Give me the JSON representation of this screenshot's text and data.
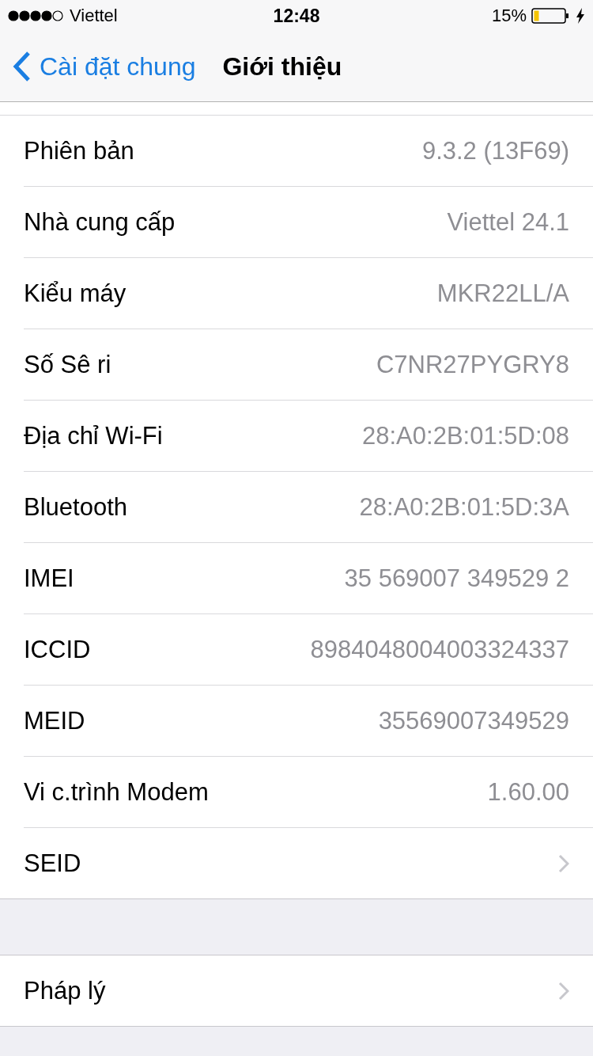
{
  "status_bar": {
    "carrier": "Viettel",
    "time": "12:48",
    "battery": "15%"
  },
  "nav": {
    "back": "Cài đặt chung",
    "title": "Giới thiệu"
  },
  "groups": [
    {
      "rows": [
        {
          "kind": "value",
          "label": "Phiên bản",
          "value": "9.3.2 (13F69)"
        },
        {
          "kind": "value",
          "label": "Nhà cung cấp",
          "value": "Viettel 24.1"
        },
        {
          "kind": "value",
          "label": "Kiểu máy",
          "value": "MKR22LL/A"
        },
        {
          "kind": "value",
          "label": "Số Sê ri",
          "value": "C7NR27PYGRY8"
        },
        {
          "kind": "value",
          "label": "Địa chỉ Wi-Fi",
          "value": "28:A0:2B:01:5D:08"
        },
        {
          "kind": "value",
          "label": "Bluetooth",
          "value": "28:A0:2B:01:5D:3A"
        },
        {
          "kind": "value",
          "label": "IMEI",
          "value": "35 569007 349529 2"
        },
        {
          "kind": "value",
          "label": "ICCID",
          "value": "8984048004003324337"
        },
        {
          "kind": "value",
          "label": "MEID",
          "value": "35569007349529"
        },
        {
          "kind": "value",
          "label": "Vi c.trình Modem",
          "value": "1.60.00"
        },
        {
          "kind": "link",
          "label": "SEID"
        }
      ]
    },
    {
      "rows": [
        {
          "kind": "link",
          "label": "Pháp lý"
        }
      ]
    }
  ]
}
